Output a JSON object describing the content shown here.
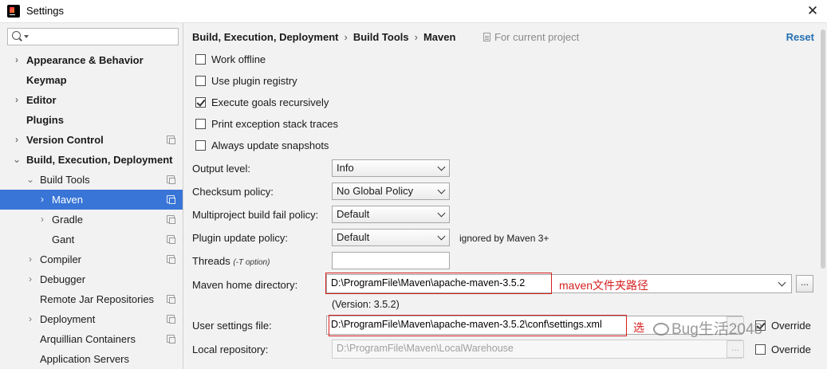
{
  "window": {
    "title": "Settings",
    "close_glyph": "✕"
  },
  "sidebar": {
    "search_placeholder": "",
    "items": [
      {
        "label": "Appearance & Behavior",
        "arrow": "›"
      },
      {
        "label": "Keymap",
        "arrow": ""
      },
      {
        "label": "Editor",
        "arrow": "›"
      },
      {
        "label": "Plugins",
        "arrow": ""
      },
      {
        "label": "Version Control",
        "arrow": "›"
      },
      {
        "label": "Build, Execution, Deployment",
        "arrow": "⌄"
      },
      {
        "label": "Build Tools",
        "arrow": "⌄"
      },
      {
        "label": "Maven",
        "arrow": "›"
      },
      {
        "label": "Gradle",
        "arrow": "›"
      },
      {
        "label": "Gant",
        "arrow": ""
      },
      {
        "label": "Compiler",
        "arrow": "›"
      },
      {
        "label": "Debugger",
        "arrow": "›"
      },
      {
        "label": "Remote Jar Repositories",
        "arrow": ""
      },
      {
        "label": "Deployment",
        "arrow": "›"
      },
      {
        "label": "Arquillian Containers",
        "arrow": ""
      },
      {
        "label": "Application Servers",
        "arrow": ""
      }
    ]
  },
  "header": {
    "breadcrumb": [
      "Build, Execution, Deployment",
      "Build Tools",
      "Maven"
    ],
    "separator": "›",
    "for_project": "For current project",
    "reset": "Reset"
  },
  "checkboxes": [
    {
      "label": "Work offline",
      "checked": false
    },
    {
      "label": "Use plugin registry",
      "checked": false
    },
    {
      "label": "Execute goals recursively",
      "checked": true
    },
    {
      "label": "Print exception stack traces",
      "checked": false
    },
    {
      "label": "Always update snapshots",
      "checked": false
    }
  ],
  "form": {
    "output_level": {
      "label": "Output level:",
      "value": "Info"
    },
    "checksum_policy": {
      "label": "Checksum policy:",
      "value": "No Global Policy"
    },
    "multiproject_policy": {
      "label": "Multiproject build fail policy:",
      "value": "Default"
    },
    "plugin_update_policy": {
      "label": "Plugin update policy:",
      "value": "Default",
      "note": "ignored by Maven 3+"
    },
    "threads": {
      "label": "Threads",
      "hint": "(-T option)",
      "value": ""
    },
    "maven_home": {
      "label": "Maven home directory:",
      "value": "D:\\ProgramFile\\Maven\\apache-maven-3.5.2",
      "version": "(Version: 3.5.2)",
      "browse": "..."
    },
    "user_settings": {
      "label": "User settings file:",
      "value": "D:\\ProgramFile\\Maven\\apache-maven-3.5.2\\conf\\settings.xml",
      "browse": "...",
      "override_label": "Override",
      "override_checked": true
    },
    "local_repo": {
      "label": "Local repository:",
      "value": "D:\\ProgramFile\\Maven\\LocalWarehouse",
      "browse": "...",
      "override_label": "Override",
      "override_checked": false
    }
  },
  "annotations": {
    "maven_home_note": "maven文件夹路径",
    "settings_note": "选"
  },
  "watermark": "Bug生活2048",
  "colors": {
    "selection": "#3875d7",
    "annotation_red": "#d61f1f",
    "link": "#2470b3"
  }
}
